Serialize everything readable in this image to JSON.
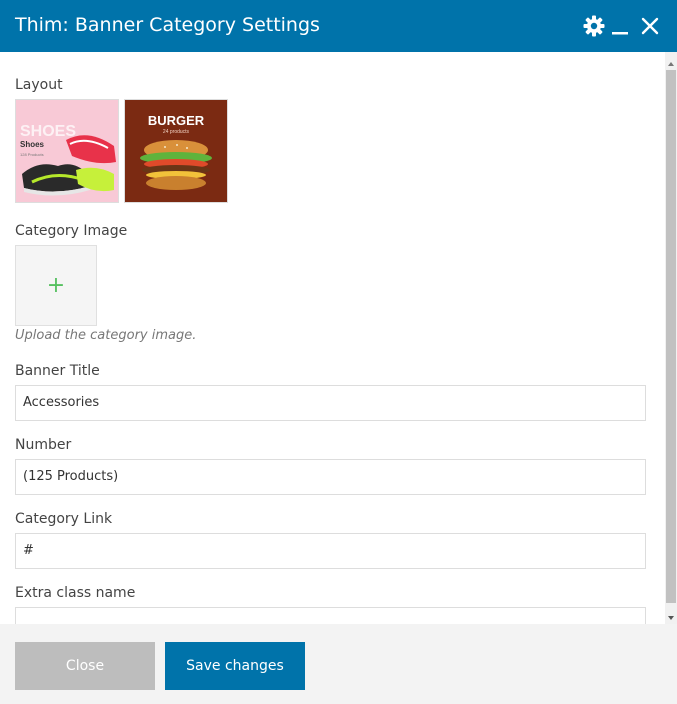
{
  "dialog": {
    "title": "Thim: Banner Category Settings",
    "accent_color": "#0073aa",
    "icons": [
      "gear-icon",
      "minimize-icon",
      "close-icon"
    ]
  },
  "form": {
    "layout": {
      "label": "Layout",
      "options": [
        {
          "name": "shoes",
          "watermark": "SHOES",
          "caption": "Shoes",
          "subcaption": "128 Products"
        },
        {
          "name": "burger",
          "caption": "BURGER",
          "subcaption": "24 products"
        }
      ]
    },
    "category_image": {
      "label": "Category Image",
      "help": "Upload the category image."
    },
    "banner_title": {
      "label": "Banner Title",
      "value": "Accessories"
    },
    "number": {
      "label": "Number",
      "value": "(125 Products)"
    },
    "category_link": {
      "label": "Category Link",
      "value": "#"
    },
    "extra_class": {
      "label": "Extra class name",
      "value": ""
    }
  },
  "footer": {
    "close_label": "Close",
    "save_label": "Save changes"
  }
}
